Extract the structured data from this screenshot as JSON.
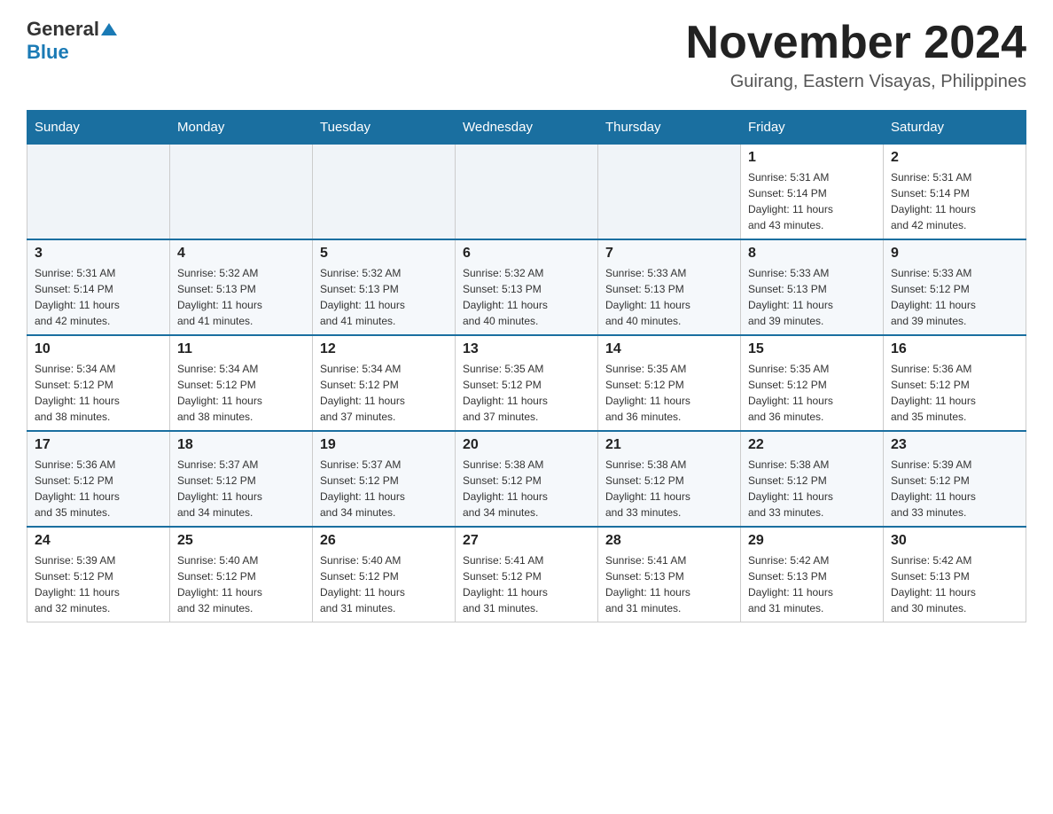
{
  "header": {
    "logo": {
      "general": "General",
      "blue": "Blue"
    },
    "title": "November 2024",
    "location": "Guirang, Eastern Visayas, Philippines"
  },
  "calendar": {
    "days_of_week": [
      "Sunday",
      "Monday",
      "Tuesday",
      "Wednesday",
      "Thursday",
      "Friday",
      "Saturday"
    ],
    "weeks": [
      [
        {
          "day": "",
          "info": ""
        },
        {
          "day": "",
          "info": ""
        },
        {
          "day": "",
          "info": ""
        },
        {
          "day": "",
          "info": ""
        },
        {
          "day": "",
          "info": ""
        },
        {
          "day": "1",
          "info": "Sunrise: 5:31 AM\nSunset: 5:14 PM\nDaylight: 11 hours\nand 43 minutes."
        },
        {
          "day": "2",
          "info": "Sunrise: 5:31 AM\nSunset: 5:14 PM\nDaylight: 11 hours\nand 42 minutes."
        }
      ],
      [
        {
          "day": "3",
          "info": "Sunrise: 5:31 AM\nSunset: 5:14 PM\nDaylight: 11 hours\nand 42 minutes."
        },
        {
          "day": "4",
          "info": "Sunrise: 5:32 AM\nSunset: 5:13 PM\nDaylight: 11 hours\nand 41 minutes."
        },
        {
          "day": "5",
          "info": "Sunrise: 5:32 AM\nSunset: 5:13 PM\nDaylight: 11 hours\nand 41 minutes."
        },
        {
          "day": "6",
          "info": "Sunrise: 5:32 AM\nSunset: 5:13 PM\nDaylight: 11 hours\nand 40 minutes."
        },
        {
          "day": "7",
          "info": "Sunrise: 5:33 AM\nSunset: 5:13 PM\nDaylight: 11 hours\nand 40 minutes."
        },
        {
          "day": "8",
          "info": "Sunrise: 5:33 AM\nSunset: 5:13 PM\nDaylight: 11 hours\nand 39 minutes."
        },
        {
          "day": "9",
          "info": "Sunrise: 5:33 AM\nSunset: 5:12 PM\nDaylight: 11 hours\nand 39 minutes."
        }
      ],
      [
        {
          "day": "10",
          "info": "Sunrise: 5:34 AM\nSunset: 5:12 PM\nDaylight: 11 hours\nand 38 minutes."
        },
        {
          "day": "11",
          "info": "Sunrise: 5:34 AM\nSunset: 5:12 PM\nDaylight: 11 hours\nand 38 minutes."
        },
        {
          "day": "12",
          "info": "Sunrise: 5:34 AM\nSunset: 5:12 PM\nDaylight: 11 hours\nand 37 minutes."
        },
        {
          "day": "13",
          "info": "Sunrise: 5:35 AM\nSunset: 5:12 PM\nDaylight: 11 hours\nand 37 minutes."
        },
        {
          "day": "14",
          "info": "Sunrise: 5:35 AM\nSunset: 5:12 PM\nDaylight: 11 hours\nand 36 minutes."
        },
        {
          "day": "15",
          "info": "Sunrise: 5:35 AM\nSunset: 5:12 PM\nDaylight: 11 hours\nand 36 minutes."
        },
        {
          "day": "16",
          "info": "Sunrise: 5:36 AM\nSunset: 5:12 PM\nDaylight: 11 hours\nand 35 minutes."
        }
      ],
      [
        {
          "day": "17",
          "info": "Sunrise: 5:36 AM\nSunset: 5:12 PM\nDaylight: 11 hours\nand 35 minutes."
        },
        {
          "day": "18",
          "info": "Sunrise: 5:37 AM\nSunset: 5:12 PM\nDaylight: 11 hours\nand 34 minutes."
        },
        {
          "day": "19",
          "info": "Sunrise: 5:37 AM\nSunset: 5:12 PM\nDaylight: 11 hours\nand 34 minutes."
        },
        {
          "day": "20",
          "info": "Sunrise: 5:38 AM\nSunset: 5:12 PM\nDaylight: 11 hours\nand 34 minutes."
        },
        {
          "day": "21",
          "info": "Sunrise: 5:38 AM\nSunset: 5:12 PM\nDaylight: 11 hours\nand 33 minutes."
        },
        {
          "day": "22",
          "info": "Sunrise: 5:38 AM\nSunset: 5:12 PM\nDaylight: 11 hours\nand 33 minutes."
        },
        {
          "day": "23",
          "info": "Sunrise: 5:39 AM\nSunset: 5:12 PM\nDaylight: 11 hours\nand 33 minutes."
        }
      ],
      [
        {
          "day": "24",
          "info": "Sunrise: 5:39 AM\nSunset: 5:12 PM\nDaylight: 11 hours\nand 32 minutes."
        },
        {
          "day": "25",
          "info": "Sunrise: 5:40 AM\nSunset: 5:12 PM\nDaylight: 11 hours\nand 32 minutes."
        },
        {
          "day": "26",
          "info": "Sunrise: 5:40 AM\nSunset: 5:12 PM\nDaylight: 11 hours\nand 31 minutes."
        },
        {
          "day": "27",
          "info": "Sunrise: 5:41 AM\nSunset: 5:12 PM\nDaylight: 11 hours\nand 31 minutes."
        },
        {
          "day": "28",
          "info": "Sunrise: 5:41 AM\nSunset: 5:13 PM\nDaylight: 11 hours\nand 31 minutes."
        },
        {
          "day": "29",
          "info": "Sunrise: 5:42 AM\nSunset: 5:13 PM\nDaylight: 11 hours\nand 31 minutes."
        },
        {
          "day": "30",
          "info": "Sunrise: 5:42 AM\nSunset: 5:13 PM\nDaylight: 11 hours\nand 30 minutes."
        }
      ]
    ]
  }
}
